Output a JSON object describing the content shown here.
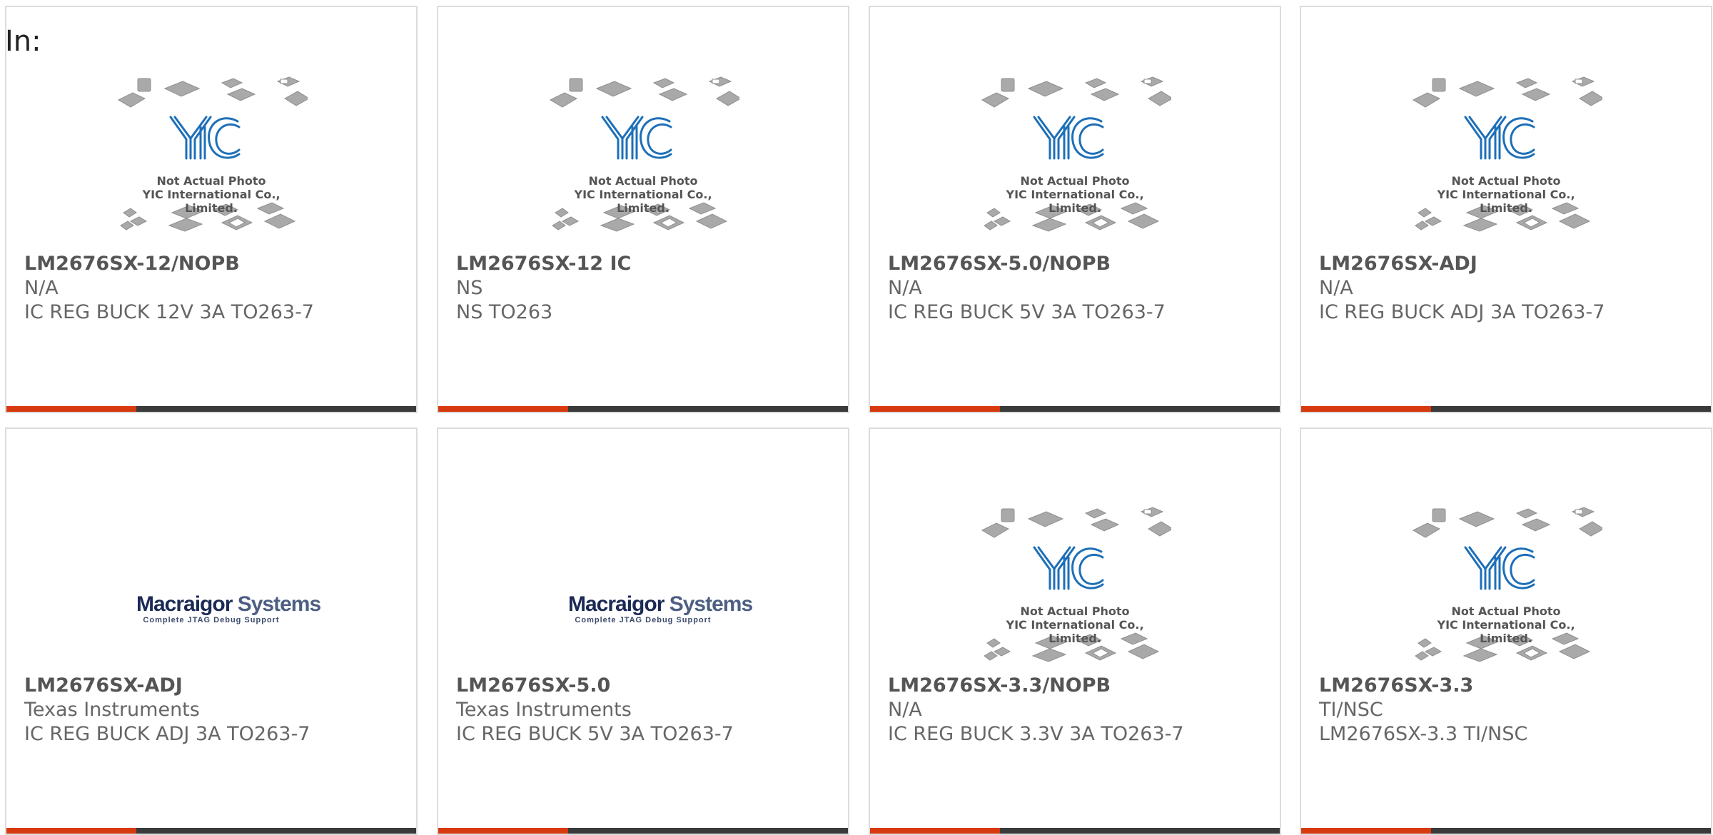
{
  "header": {
    "in_label": "In:"
  },
  "placeholder": {
    "yic_logo": "YIC",
    "line1": "Not Actual Photo",
    "line2": "YIC International Co., Limited."
  },
  "macraigor": {
    "brand_part1": "Macraigor",
    "brand_part2": "Systems",
    "tagline": "Complete JTAG Debug Support"
  },
  "colors": {
    "accent": "#d63a0e",
    "bar": "#3a3a3a",
    "border": "#dcdcdc",
    "yic_blue": "#1d6fb8"
  },
  "products": [
    {
      "part": "LM2676SX-12/NOPB",
      "maker": "N/A",
      "desc": "IC REG BUCK 12V 3A TO263-7",
      "image": "yic-placeholder"
    },
    {
      "part": "LM2676SX-12 IC",
      "maker": "NS",
      "desc": "NS TO263",
      "image": "yic-placeholder"
    },
    {
      "part": "LM2676SX-5.0/NOPB",
      "maker": "N/A",
      "desc": "IC REG BUCK 5V 3A TO263-7",
      "image": "yic-placeholder"
    },
    {
      "part": "LM2676SX-ADJ",
      "maker": "N/A",
      "desc": "IC REG BUCK ADJ 3A TO263-7",
      "image": "yic-placeholder"
    },
    {
      "part": "LM2676SX-ADJ",
      "maker": "Texas Instruments",
      "desc": "IC REG BUCK ADJ 3A TO263-7",
      "image": "macraigor-logo"
    },
    {
      "part": "LM2676SX-5.0",
      "maker": "Texas Instruments",
      "desc": "IC REG BUCK 5V 3A TO263-7",
      "image": "macraigor-logo"
    },
    {
      "part": "LM2676SX-3.3/NOPB",
      "maker": "N/A",
      "desc": "IC REG BUCK 3.3V 3A TO263-7",
      "image": "yic-placeholder"
    },
    {
      "part": "LM2676SX-3.3",
      "maker": "TI/NSC",
      "desc": "LM2676SX-3.3 TI/NSC",
      "image": "yic-placeholder"
    }
  ]
}
